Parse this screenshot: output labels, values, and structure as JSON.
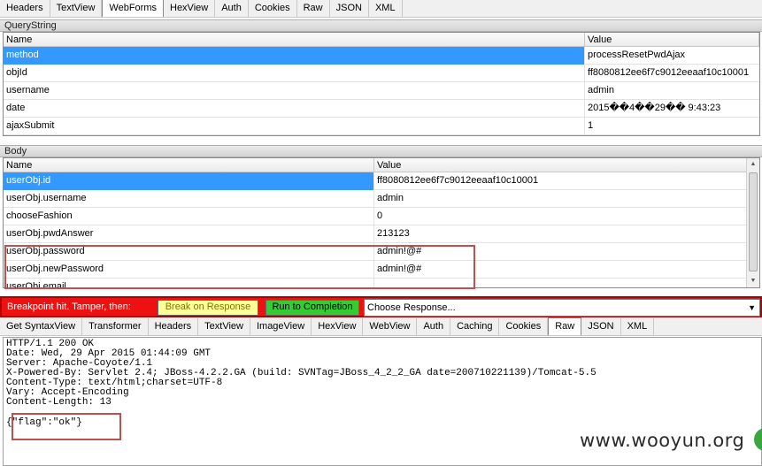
{
  "request_tabs": [
    {
      "label": "Headers"
    },
    {
      "label": "TextView"
    },
    {
      "label": "WebForms",
      "active": true
    },
    {
      "label": "HexView"
    },
    {
      "label": "Auth"
    },
    {
      "label": "Cookies"
    },
    {
      "label": "Raw"
    },
    {
      "label": "JSON"
    },
    {
      "label": "XML"
    }
  ],
  "querystring": {
    "section_title": "QueryString",
    "col_name": "Name",
    "col_value": "Value",
    "rows": [
      {
        "name": "method",
        "value": "processResetPwdAjax",
        "selected": true
      },
      {
        "name": "objId",
        "value": "ff8080812ee6f7c9012eeaaf10c10001"
      },
      {
        "name": "username",
        "value": "admin"
      },
      {
        "name": "date",
        "value": "2015��4��29�� 9:43:23"
      },
      {
        "name": "ajaxSubmit",
        "value": "1"
      }
    ]
  },
  "body": {
    "section_title": "Body",
    "col_name": "Name",
    "col_value": "Value",
    "rows": [
      {
        "name": "userObj.id",
        "value": "ff8080812ee6f7c9012eeaaf10c10001",
        "selected": true
      },
      {
        "name": "userObj.username",
        "value": "admin"
      },
      {
        "name": "chooseFashion",
        "value": "0"
      },
      {
        "name": "userObj.pwdAnswer",
        "value": "213123"
      },
      {
        "name": "userObj.password",
        "value": "admin!@#"
      },
      {
        "name": "userObj.newPassword",
        "value": "admin!@#"
      },
      {
        "name": "userObj.email",
        "value": ""
      }
    ]
  },
  "breakpoint": {
    "label": "Breakpoint hit. Tamper, then:",
    "break_on_response": "Break on Response",
    "run_to_completion": "Run to Completion",
    "choose_response": "Choose Response..."
  },
  "response_tabs": [
    {
      "label": "Get SyntaxView"
    },
    {
      "label": "Transformer"
    },
    {
      "label": "Headers"
    },
    {
      "label": "TextView"
    },
    {
      "label": "ImageView"
    },
    {
      "label": "HexView"
    },
    {
      "label": "WebView"
    },
    {
      "label": "Auth"
    },
    {
      "label": "Caching"
    },
    {
      "label": "Cookies"
    },
    {
      "label": "Raw",
      "active": true
    },
    {
      "label": "JSON"
    },
    {
      "label": "XML"
    }
  ],
  "response_raw": {
    "lines": [
      "HTTP/1.1 200 OK",
      "Date: Wed, 29 Apr 2015 01:44:09 GMT",
      "Server: Apache-Coyote/1.1",
      "X-Powered-By: Servlet 2.4; JBoss-4.2.2.GA (build: SVNTag=JBoss_4_2_2_GA date=200710221139)/Tomcat-5.5",
      "Content-Type: text/html;charset=UTF-8",
      "Vary: Accept-Encoding",
      "Content-Length: 13"
    ],
    "body": "{\"flag\":\"ok\"}"
  },
  "watermark": "www.wooyun.org",
  "colors": {
    "selection": "#3399ff",
    "breakpoint_bar": "#ee1111",
    "highlight_box": "#c0504d",
    "break_button": "#ffff99",
    "run_button": "#33cc33"
  }
}
